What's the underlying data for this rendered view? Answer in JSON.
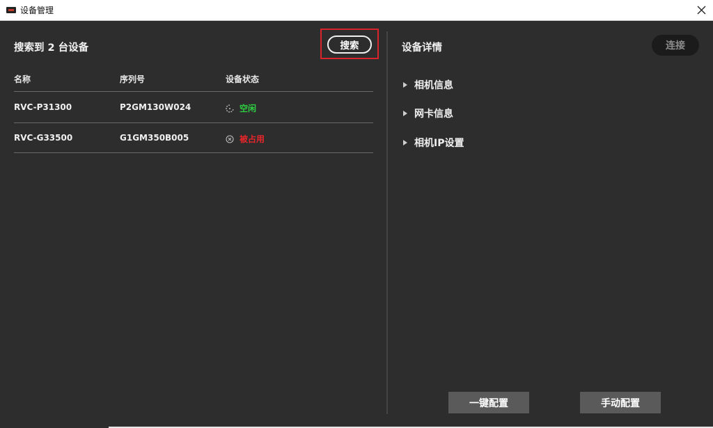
{
  "window": {
    "title": "设备管理",
    "icon": "app-icon",
    "close_icon": "close-icon"
  },
  "left": {
    "found_label": "搜索到 2 台设备",
    "search_label": "搜索",
    "columns": [
      "名称",
      "序列号",
      "设备状态"
    ],
    "devices": [
      {
        "name": "RVC-P31300",
        "serial": "P2GM130W024",
        "status": "空闲",
        "status_icon": "idle-spinner-icon"
      },
      {
        "name": "RVC-G33500",
        "serial": "G1GM350B005",
        "status": "被占用",
        "status_icon": "occupied-x-circle-icon"
      }
    ]
  },
  "right": {
    "title": "设备详情",
    "connect_label": "连接",
    "sections": [
      "相机信息",
      "网卡信息",
      "相机IP设置"
    ],
    "one_click_config": "一键配置",
    "manual_config": "手动配置"
  },
  "colors": {
    "background": "#2d2d2d",
    "idle": "#2ecc40",
    "occupied": "#e8262a",
    "highlight": "#d9242b"
  }
}
